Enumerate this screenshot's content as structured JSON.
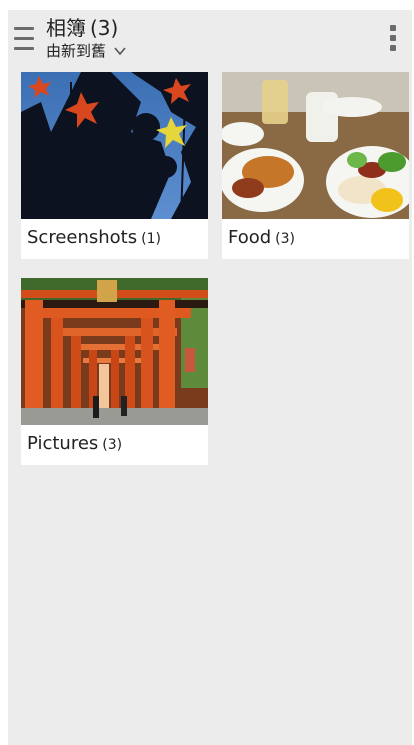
{
  "header": {
    "title": "相簿",
    "count": "(3)",
    "sort_label": "由新到舊"
  },
  "albums": [
    {
      "name": "Screenshots",
      "count": "(1)"
    },
    {
      "name": "Food",
      "count": "(3)"
    },
    {
      "name": "Pictures",
      "count": "(3)"
    }
  ],
  "icons": {
    "menu": "hamburger-menu-icon",
    "overflow": "overflow-menu-icon",
    "sort": "chevron-down-icon"
  },
  "colors": {
    "background": "#ececec",
    "icon_gray": "#6b6b6b",
    "torii_orange": "#d9551f"
  }
}
